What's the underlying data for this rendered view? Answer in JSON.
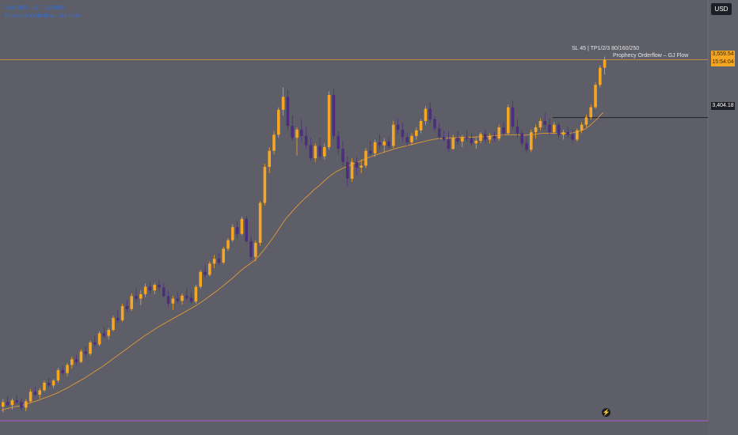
{
  "header": {
    "symbol_line": "XAUUSD · 1D · OANDA",
    "indicator_line": "Prophecy Orderflow – GJ Flow"
  },
  "currency": "USD",
  "price_tags": {
    "last": "3,559.54",
    "countdown": "15:54:04",
    "level": "3,404.18"
  },
  "notes": {
    "sl_tp": "SL 45 | TP1/2/3 80/160/250",
    "indicator": "Prophecy Orderflow – GJ Flow"
  },
  "colors": {
    "background": "#5d5e68",
    "bull": "#f5a623",
    "bear": "#4b2f7a",
    "ma": "#f0a030",
    "level_line": "#1e1f24",
    "price_line": "#c8963c",
    "axis_bottom": "#b455d6"
  },
  "icons": {
    "bottom": "lightning-bolt-icon"
  },
  "chart_data": {
    "type": "candlestick",
    "title": "",
    "xlabel": "",
    "ylabel": "",
    "ylim": [
      2590,
      3720
    ],
    "candles": [
      [
        2628,
        2648,
        2612,
        2640
      ],
      [
        2640,
        2655,
        2628,
        2632
      ],
      [
        2632,
        2650,
        2620,
        2645
      ],
      [
        2645,
        2660,
        2635,
        2640
      ],
      [
        2640,
        2650,
        2618,
        2625
      ],
      [
        2625,
        2648,
        2615,
        2642
      ],
      [
        2642,
        2675,
        2638,
        2668
      ],
      [
        2668,
        2682,
        2655,
        2660
      ],
      [
        2660,
        2678,
        2650,
        2672
      ],
      [
        2672,
        2698,
        2668,
        2692
      ],
      [
        2692,
        2705,
        2680,
        2685
      ],
      [
        2685,
        2702,
        2678,
        2698
      ],
      [
        2698,
        2732,
        2692,
        2726
      ],
      [
        2726,
        2738,
        2712,
        2718
      ],
      [
        2718,
        2745,
        2710,
        2740
      ],
      [
        2740,
        2762,
        2730,
        2755
      ],
      [
        2755,
        2768,
        2740,
        2748
      ],
      [
        2748,
        2782,
        2745,
        2776
      ],
      [
        2776,
        2790,
        2762,
        2770
      ],
      [
        2770,
        2805,
        2765,
        2800
      ],
      [
        2800,
        2818,
        2788,
        2795
      ],
      [
        2795,
        2830,
        2790,
        2825
      ],
      [
        2825,
        2842,
        2812,
        2818
      ],
      [
        2818,
        2840,
        2808,
        2834
      ],
      [
        2834,
        2872,
        2830,
        2866
      ],
      [
        2866,
        2888,
        2852,
        2860
      ],
      [
        2860,
        2905,
        2856,
        2898
      ],
      [
        2898,
        2915,
        2882,
        2890
      ],
      [
        2890,
        2932,
        2885,
        2925
      ],
      [
        2925,
        2945,
        2910,
        2918
      ],
      [
        2918,
        2940,
        2900,
        2930
      ],
      [
        2930,
        2958,
        2922,
        2950
      ],
      [
        2950,
        2962,
        2932,
        2940
      ],
      [
        2940,
        2960,
        2930,
        2955
      ],
      [
        2955,
        2968,
        2940,
        2948
      ],
      [
        2948,
        2962,
        2920,
        2925
      ],
      [
        2925,
        2940,
        2895,
        2905
      ],
      [
        2905,
        2925,
        2888,
        2918
      ],
      [
        2918,
        2935,
        2905,
        2912
      ],
      [
        2912,
        2932,
        2902,
        2926
      ],
      [
        2926,
        2945,
        2915,
        2920
      ],
      [
        2920,
        2935,
        2905,
        2910
      ],
      [
        2910,
        2955,
        2905,
        2950
      ],
      [
        2950,
        2995,
        2945,
        2990
      ],
      [
        2990,
        3010,
        2975,
        2982
      ],
      [
        2982,
        3018,
        2978,
        3012
      ],
      [
        3012,
        3035,
        3000,
        3025
      ],
      [
        3025,
        3040,
        3008,
        3015
      ],
      [
        3015,
        3058,
        3010,
        3052
      ],
      [
        3052,
        3080,
        3045,
        3075
      ],
      [
        3075,
        3118,
        3070,
        3110
      ],
      [
        3110,
        3125,
        3080,
        3092
      ],
      [
        3092,
        3138,
        3088,
        3132
      ],
      [
        3132,
        3140,
        3068,
        3072
      ],
      [
        3072,
        3085,
        3020,
        3030
      ],
      [
        3030,
        3075,
        3018,
        3068
      ],
      [
        3068,
        3180,
        3060,
        3175
      ],
      [
        3175,
        3280,
        3168,
        3272
      ],
      [
        3272,
        3325,
        3255,
        3315
      ],
      [
        3315,
        3368,
        3305,
        3358
      ],
      [
        3358,
        3432,
        3350,
        3425
      ],
      [
        3425,
        3485,
        3410,
        3460
      ],
      [
        3460,
        3478,
        3372,
        3382
      ],
      [
        3382,
        3410,
        3342,
        3350
      ],
      [
        3350,
        3378,
        3302,
        3372
      ],
      [
        3372,
        3400,
        3340,
        3355
      ],
      [
        3355,
        3382,
        3320,
        3330
      ],
      [
        3330,
        3350,
        3288,
        3295
      ],
      [
        3295,
        3335,
        3285,
        3328
      ],
      [
        3328,
        3350,
        3290,
        3300
      ],
      [
        3300,
        3335,
        3292,
        3325
      ],
      [
        3325,
        3475,
        3318,
        3465
      ],
      [
        3465,
        3480,
        3345,
        3355
      ],
      [
        3355,
        3368,
        3305,
        3320
      ],
      [
        3320,
        3340,
        3275,
        3285
      ],
      [
        3285,
        3300,
        3220,
        3240
      ],
      [
        3240,
        3295,
        3232,
        3285
      ],
      [
        3285,
        3298,
        3250,
        3270
      ],
      [
        3270,
        3292,
        3255,
        3275
      ],
      [
        3275,
        3322,
        3268,
        3315
      ],
      [
        3315,
        3342,
        3300,
        3308
      ],
      [
        3308,
        3345,
        3298,
        3338
      ],
      [
        3338,
        3360,
        3320,
        3330
      ],
      [
        3330,
        3348,
        3310,
        3340
      ],
      [
        3340,
        3352,
        3322,
        3328
      ],
      [
        3328,
        3395,
        3322,
        3385
      ],
      [
        3385,
        3402,
        3360,
        3372
      ],
      [
        3372,
        3390,
        3340,
        3352
      ],
      [
        3352,
        3365,
        3328,
        3338
      ],
      [
        3338,
        3362,
        3330,
        3355
      ],
      [
        3355,
        3378,
        3345,
        3370
      ],
      [
        3370,
        3400,
        3362,
        3395
      ],
      [
        3395,
        3435,
        3385,
        3428
      ],
      [
        3428,
        3445,
        3390,
        3400
      ],
      [
        3400,
        3408,
        3368,
        3375
      ],
      [
        3375,
        3390,
        3345,
        3352
      ],
      [
        3352,
        3370,
        3340,
        3345
      ],
      [
        3345,
        3368,
        3312,
        3320
      ],
      [
        3320,
        3358,
        3318,
        3350
      ],
      [
        3350,
        3368,
        3332,
        3340
      ],
      [
        3340,
        3358,
        3325,
        3352
      ],
      [
        3352,
        3370,
        3340,
        3348
      ],
      [
        3348,
        3362,
        3328,
        3335
      ],
      [
        3335,
        3350,
        3320,
        3342
      ],
      [
        3342,
        3365,
        3335,
        3360
      ],
      [
        3360,
        3372,
        3338,
        3345
      ],
      [
        3345,
        3362,
        3335,
        3355
      ],
      [
        3355,
        3365,
        3340,
        3348
      ],
      [
        3348,
        3385,
        3342,
        3378
      ],
      [
        3378,
        3392,
        3355,
        3362
      ],
      [
        3362,
        3440,
        3358,
        3432
      ],
      [
        3432,
        3450,
        3372,
        3380
      ],
      [
        3380,
        3400,
        3350,
        3362
      ],
      [
        3362,
        3370,
        3328,
        3335
      ],
      [
        3335,
        3352,
        3310,
        3318
      ],
      [
        3318,
        3372,
        3312,
        3365
      ],
      [
        3365,
        3385,
        3348,
        3378
      ],
      [
        3378,
        3402,
        3370,
        3395
      ],
      [
        3395,
        3418,
        3372,
        3385
      ],
      [
        3385,
        3402,
        3358,
        3365
      ],
      [
        3365,
        3392,
        3360,
        3385
      ],
      [
        3385,
        3392,
        3350,
        3358
      ],
      [
        3358,
        3372,
        3345,
        3365
      ],
      [
        3365,
        3380,
        3350,
        3358
      ],
      [
        3358,
        3372,
        3338,
        3345
      ],
      [
        3345,
        3375,
        3340,
        3370
      ],
      [
        3370,
        3392,
        3362,
        3385
      ],
      [
        3385,
        3412,
        3378,
        3405
      ],
      [
        3405,
        3440,
        3398,
        3432
      ],
      [
        3432,
        3500,
        3428,
        3492
      ],
      [
        3492,
        3545,
        3485,
        3538
      ],
      [
        3538,
        3568,
        3520,
        3559.54
      ]
    ],
    "series": [
      {
        "values": [
          2618,
          2622,
          2625,
          2628,
          2630,
          2633,
          2637,
          2641,
          2645,
          2650,
          2654,
          2659,
          2664,
          2670,
          2676,
          2683,
          2690,
          2697,
          2704,
          2712,
          2720,
          2728,
          2736,
          2745,
          2754,
          2763,
          2772,
          2781,
          2790,
          2799,
          2808,
          2817,
          2825,
          2833,
          2841,
          2848,
          2855,
          2862,
          2869,
          2876,
          2883,
          2890,
          2897,
          2905,
          2913,
          2922,
          2931,
          2940,
          2950,
          2960,
          2970,
          2981,
          2992,
          3002,
          3011,
          3020,
          3032,
          3047,
          3063,
          3080,
          3098,
          3117,
          3134,
          3148,
          3162,
          3175,
          3187,
          3198,
          3210,
          3220,
          3231,
          3242,
          3252,
          3260,
          3266,
          3272,
          3277,
          3282,
          3287,
          3292,
          3297,
          3302,
          3306,
          3310,
          3314,
          3318,
          3322,
          3325,
          3328,
          3331,
          3334,
          3337,
          3340,
          3343,
          3346,
          3347,
          3348,
          3349,
          3350,
          3350,
          3351,
          3351,
          3352,
          3352,
          3353,
          3353,
          3354,
          3355,
          3356,
          3357,
          3358,
          3358,
          3358,
          3357,
          3357,
          3358,
          3359,
          3361,
          3362,
          3362,
          3362,
          3362,
          3362,
          3362,
          3363,
          3365,
          3368,
          3373,
          3382,
          3393,
          3405,
          3418
        ]
      }
    ],
    "reference_levels": [
      3559.54,
      3404.18
    ],
    "level_segment_start_index": 120,
    "grid": false,
    "legend": "none"
  }
}
